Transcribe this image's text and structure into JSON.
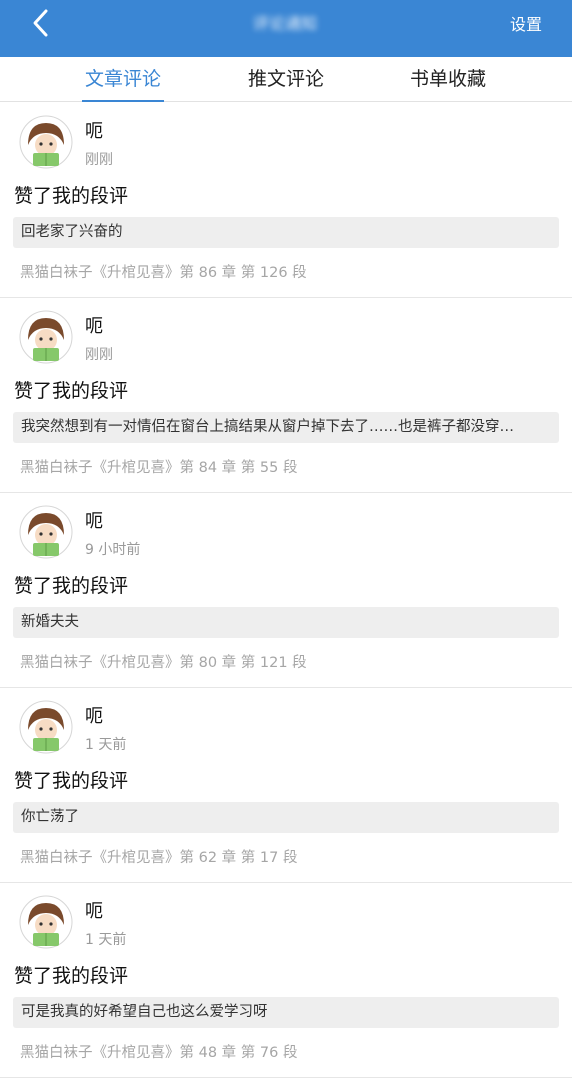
{
  "header": {
    "title": "评论通知",
    "settings_label": "设置",
    "bar_color": "#3a86d4",
    "back_icon": "chevron-left-icon"
  },
  "tabs": [
    {
      "label": "文章评论",
      "active": true
    },
    {
      "label": "推文评论",
      "active": false
    },
    {
      "label": "书单收藏",
      "active": false
    }
  ],
  "accent_color": "#3a86d4",
  "notifications": [
    {
      "user": "呃",
      "time": "刚刚",
      "action": "赞了我的段评",
      "quote": "回老家了兴奋的",
      "source": "黑猫白袜子《升棺见喜》第 86 章 第 126 段"
    },
    {
      "user": "呃",
      "time": "刚刚",
      "action": "赞了我的段评",
      "quote": "我突然想到有一对情侣在窗台上搞结果从窗户掉下去了……也是裤子都没穿…",
      "source": "黑猫白袜子《升棺见喜》第 84 章 第 55 段"
    },
    {
      "user": "呃",
      "time": "9 小时前",
      "action": "赞了我的段评",
      "quote": "新婚夫夫",
      "source": "黑猫白袜子《升棺见喜》第 80 章 第 121 段"
    },
    {
      "user": "呃",
      "time": "1 天前",
      "action": "赞了我的段评",
      "quote": "你亡荡了",
      "source": "黑猫白袜子《升棺见喜》第 62 章 第 17 段"
    },
    {
      "user": "呃",
      "time": "1 天前",
      "action": "赞了我的段评",
      "quote": "可是我真的好希望自己也这么爱学习呀",
      "source": "黑猫白袜子《升棺见喜》第 48 章 第 76 段"
    }
  ]
}
